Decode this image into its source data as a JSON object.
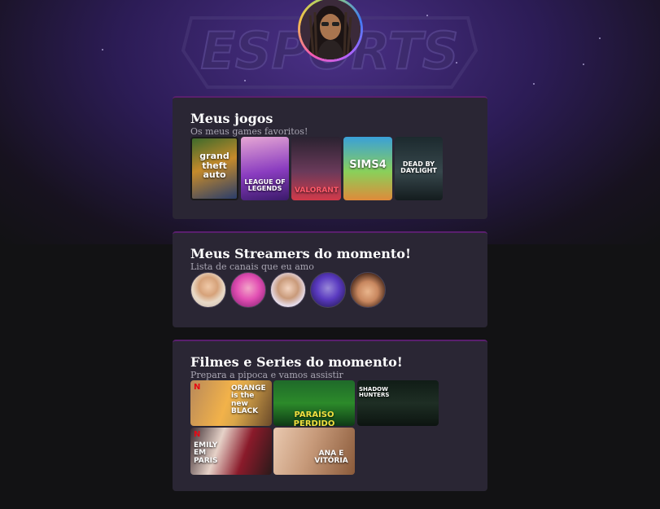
{
  "hero": {
    "logo_text": "ESPORTS"
  },
  "profile": {
    "avatar_alt": "profile photo"
  },
  "games": {
    "title": "Meus jogos",
    "subtitle": "Os meus games favoritos!",
    "items": [
      {
        "name": "grand theft auto V",
        "label": "grand theft auto"
      },
      {
        "name": "League of Legends",
        "label": "LEAGUE OF LEGENDS"
      },
      {
        "name": "Valorant",
        "label": "VALORANT"
      },
      {
        "name": "The Sims 4",
        "label": "SIMS4"
      },
      {
        "name": "Dead by Daylight",
        "label": "DEAD BY DAYLIGHT"
      }
    ]
  },
  "streamers": {
    "title": "Meus Streamers do momento!",
    "subtitle": "Lista de canais que eu amo",
    "items": [
      {
        "name": "streamer-1"
      },
      {
        "name": "streamer-2"
      },
      {
        "name": "streamer-3"
      },
      {
        "name": "streamer-4"
      },
      {
        "name": "streamer-5"
      }
    ]
  },
  "shows": {
    "title": "Filmes e Series do momento!",
    "subtitle": "Prepara a pipoca e vamos assistir",
    "netflix_badge": "N",
    "items": [
      {
        "name": "Orange is the New Black",
        "label": "ORANGE is the new BLACK"
      },
      {
        "name": "Paraíso Perdido",
        "label": "PARAÍSO PERDIDO"
      },
      {
        "name": "Shadowhunters",
        "label": "SHADOW HUNTERS"
      },
      {
        "name": "Emily em Paris",
        "label": "EMILY EM PARIS"
      },
      {
        "name": "Ana e Vitória",
        "label": "ANA E VITÓRIA"
      }
    ]
  }
}
